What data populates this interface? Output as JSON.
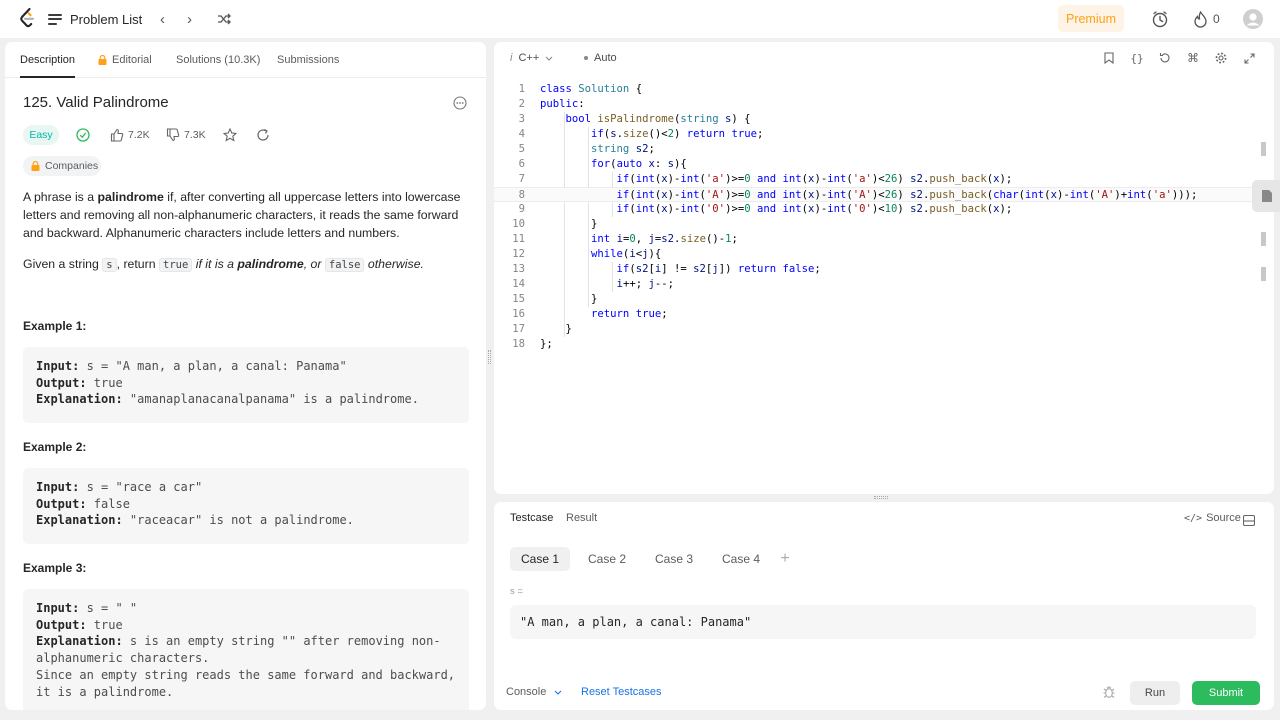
{
  "nav": {
    "problem_list": "Problem List",
    "premium": "Premium",
    "streak": "0"
  },
  "tabs": {
    "description": "Description",
    "editorial": "Editorial",
    "solutions": "Solutions (10.3K)",
    "submissions": "Submissions"
  },
  "problem": {
    "title": "125. Valid Palindrome",
    "difficulty": "Easy",
    "likes": "7.2K",
    "dislikes": "7.3K",
    "companies": "Companies",
    "p1_a": "A phrase is a ",
    "p1_b": "palindrome",
    "p1_c": " if, after converting all uppercase letters into lowercase letters and removing all non-alphanumeric characters, it reads the same forward and backward. Alphanumeric characters include letters and numbers.",
    "p2_a": "Given a string ",
    "p2_s": "s",
    "p2_b": ", return ",
    "p2_true": "true",
    "p2_c": " if it is a ",
    "p2_d": "palindrome",
    "p2_e": ", or ",
    "p2_false": "false",
    "p2_f": " otherwise."
  },
  "examples": [
    {
      "title": "Example 1:",
      "input_label": "Input:",
      "input": " s = \"A man, a plan, a canal: Panama\"",
      "output_label": "Output:",
      "output": " true",
      "expl_label": "Explanation:",
      "expl": " \"amanaplanacanalpanama\" is a palindrome."
    },
    {
      "title": "Example 2:",
      "input_label": "Input:",
      "input": " s = \"race a car\"",
      "output_label": "Output:",
      "output": " false",
      "expl_label": "Explanation:",
      "expl": " \"raceacar\" is not a palindrome."
    },
    {
      "title": "Example 3:",
      "input_label": "Input:",
      "input": " s = \" \"",
      "output_label": "Output:",
      "output": " true",
      "expl_label": "Explanation:",
      "expl": " s is an empty string \"\" after removing non-",
      "expl2": "alphanumeric characters.",
      "expl3": "Since an empty string reads the same forward and backward,",
      "expl4": "it is a palindrome."
    }
  ],
  "editor": {
    "language": "C++",
    "mode": "Auto"
  },
  "code_lines": [
    {
      "n": "1",
      "t": "class Solution {"
    },
    {
      "n": "2",
      "t": "public:"
    },
    {
      "n": "3",
      "t": "    bool isPalindrome(string s) {"
    },
    {
      "n": "4",
      "t": "        if(s.size()<2) return true;"
    },
    {
      "n": "5",
      "t": "        string s2;"
    },
    {
      "n": "6",
      "t": "        for(auto x: s){"
    },
    {
      "n": "7",
      "t": "            if(int(x)-int('a')>=0 and int(x)-int('a')<26) s2.push_back(x);"
    },
    {
      "n": "8",
      "t": "            if(int(x)-int('A')>=0 and int(x)-int('A')<26) s2.push_back(char(int(x)-int('A')+int('a')));"
    },
    {
      "n": "9",
      "t": "            if(int(x)-int('0')>=0 and int(x)-int('0')<10) s2.push_back(x);"
    },
    {
      "n": "10",
      "t": "        }"
    },
    {
      "n": "11",
      "t": "        int i=0, j=s2.size()-1;"
    },
    {
      "n": "12",
      "t": "        while(i<j){"
    },
    {
      "n": "13",
      "t": "            if(s2[i] != s2[j]) return false;"
    },
    {
      "n": "14",
      "t": "            i++; j--;"
    },
    {
      "n": "15",
      "t": "        }"
    },
    {
      "n": "16",
      "t": "        return true;"
    },
    {
      "n": "17",
      "t": "    }"
    },
    {
      "n": "18",
      "t": "};"
    }
  ],
  "testpanel": {
    "testcase_tab": "Testcase",
    "result_tab": "Result",
    "source": "Source",
    "cases": [
      "Case 1",
      "Case 2",
      "Case 3",
      "Case 4"
    ],
    "add": "+",
    "var_label": "s =",
    "value": "\"A man, a plan, a canal: Panama\"",
    "console": "Console",
    "reset": "Reset Testcases",
    "run": "Run",
    "submit": "Submit"
  },
  "colors": {
    "accent_orange": "#ffa116",
    "easy": "#00b8a3",
    "submit_green": "#2cbb5d",
    "link_blue": "#1a73e8"
  }
}
